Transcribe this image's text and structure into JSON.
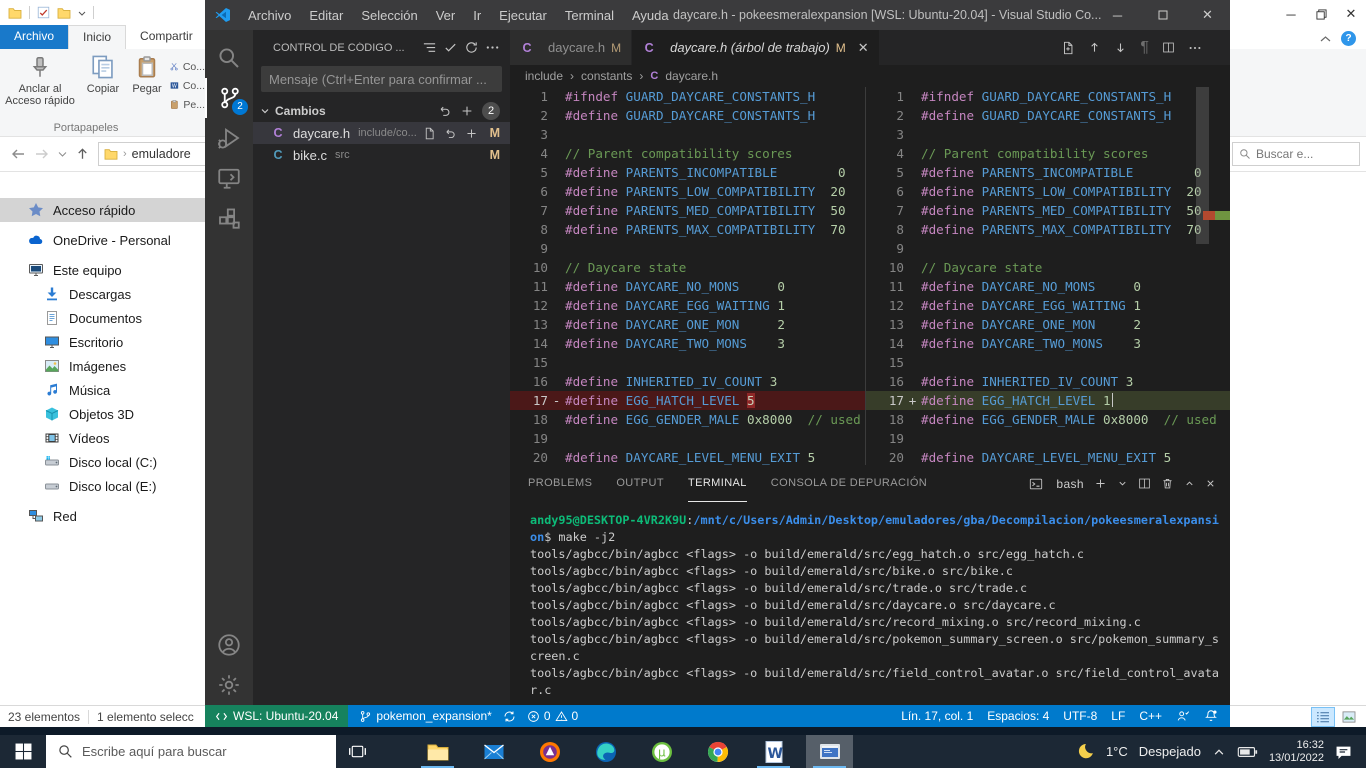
{
  "explorer": {
    "tabs": {
      "file": "Archivo",
      "home": "Inicio",
      "share": "Compartir"
    },
    "ribbon": {
      "pin_line1": "Anclar al",
      "pin_line2": "Acceso rápido",
      "copy": "Copiar",
      "paste": "Pegar",
      "cut_small": "Co...",
      "copy_path_small": "Co...",
      "paste_shortcut_small": "Pe...",
      "group": "Portapapeles"
    },
    "address_crumb": "emuladore",
    "search_placeholder": "Buscar e...",
    "nav": [
      {
        "label": "Acceso rápido",
        "icon": "star",
        "level": 0,
        "selected": true
      },
      {
        "label": "OneDrive - Personal",
        "icon": "cloud",
        "level": 0
      },
      {
        "label": "Este equipo",
        "icon": "pc",
        "level": 0
      },
      {
        "label": "Descargas",
        "icon": "download",
        "level": 1
      },
      {
        "label": "Documentos",
        "icon": "document",
        "level": 1
      },
      {
        "label": "Escritorio",
        "icon": "desktop",
        "level": 1
      },
      {
        "label": "Imágenes",
        "icon": "image",
        "level": 1
      },
      {
        "label": "Música",
        "icon": "music",
        "level": 1
      },
      {
        "label": "Objetos 3D",
        "icon": "cube",
        "level": 1
      },
      {
        "label": "Vídeos",
        "icon": "video",
        "level": 1
      },
      {
        "label": "Disco local (C:)",
        "icon": "drive-c",
        "level": 1
      },
      {
        "label": "Disco local (E:)",
        "icon": "drive",
        "level": 1
      },
      {
        "label": "Red",
        "icon": "network",
        "level": 0
      }
    ],
    "status": {
      "items": "23 elementos",
      "selected": "1 elemento selecc"
    }
  },
  "vscode": {
    "titlebar": {
      "menus": [
        "Archivo",
        "Editar",
        "Selección",
        "Ver",
        "Ir",
        "Ejecutar",
        "Terminal",
        "Ayuda"
      ],
      "title": "daycare.h - pokeesmeralexpansion [WSL: Ubuntu-20.04] - Visual Studio Co..."
    },
    "activitybar": {
      "items": [
        {
          "icon": "search",
          "name": "search"
        },
        {
          "icon": "source-control",
          "name": "source-control",
          "active": true,
          "badge": "2"
        },
        {
          "icon": "debug",
          "name": "run-and-debug"
        },
        {
          "icon": "remote",
          "name": "remote-explorer"
        },
        {
          "icon": "extensions",
          "name": "extensions"
        }
      ],
      "bottom": [
        {
          "icon": "account",
          "name": "accounts"
        },
        {
          "icon": "gear",
          "name": "settings"
        }
      ]
    },
    "scm": {
      "title": "CONTROL DE CÓDIGO ...",
      "message_placeholder": "Mensaje (Ctrl+Enter para confirmar ...",
      "changes_label": "Cambios",
      "changes_count": "2",
      "files": [
        {
          "name": "daycare.h",
          "path": "include/co...",
          "badge": "M"
        },
        {
          "name": "bike.c",
          "path": "src",
          "badge": "M"
        }
      ]
    },
    "editor": {
      "tabs": [
        {
          "name": "daycare.h",
          "badge": "M"
        },
        {
          "name": "daycare.h (árbol de trabajo)",
          "badge": "M"
        }
      ],
      "breadcrumb": [
        "include",
        "constants",
        "daycare.h"
      ]
    },
    "diff": {
      "left": [
        {
          "n": "1",
          "s": [
            [
              "d",
              "#ifndef"
            ],
            [
              "i",
              " GUARD_DAYCARE_CONSTANTS_H"
            ]
          ]
        },
        {
          "n": "2",
          "s": [
            [
              "d",
              "#define"
            ],
            [
              "i",
              " GUARD_DAYCARE_CONSTANTS_H"
            ]
          ]
        },
        {
          "n": "3",
          "s": []
        },
        {
          "n": "4",
          "s": [
            [
              "c",
              "// Parent compatibility scores"
            ]
          ]
        },
        {
          "n": "5",
          "s": [
            [
              "d",
              "#define"
            ],
            [
              "i",
              " PARENTS_INCOMPATIBLE"
            ],
            [
              "u",
              "        0"
            ]
          ]
        },
        {
          "n": "6",
          "s": [
            [
              "d",
              "#define"
            ],
            [
              "i",
              " PARENTS_LOW_COMPATIBILITY"
            ],
            [
              "u",
              "  20"
            ]
          ]
        },
        {
          "n": "7",
          "s": [
            [
              "d",
              "#define"
            ],
            [
              "i",
              " PARENTS_MED_COMPATIBILITY"
            ],
            [
              "u",
              "  50"
            ]
          ]
        },
        {
          "n": "8",
          "s": [
            [
              "d",
              "#define"
            ],
            [
              "i",
              " PARENTS_MAX_COMPATIBILITY"
            ],
            [
              "u",
              "  70"
            ]
          ]
        },
        {
          "n": "9",
          "s": []
        },
        {
          "n": "10",
          "s": [
            [
              "c",
              "// Daycare state"
            ]
          ]
        },
        {
          "n": "11",
          "s": [
            [
              "d",
              "#define"
            ],
            [
              "i",
              " DAYCARE_NO_MONS"
            ],
            [
              "u",
              "     0"
            ]
          ]
        },
        {
          "n": "12",
          "s": [
            [
              "d",
              "#define"
            ],
            [
              "i",
              " DAYCARE_EGG_WAITING"
            ],
            [
              "u",
              " 1"
            ]
          ]
        },
        {
          "n": "13",
          "s": [
            [
              "d",
              "#define"
            ],
            [
              "i",
              " DAYCARE_ONE_MON"
            ],
            [
              "u",
              "     2"
            ]
          ]
        },
        {
          "n": "14",
          "s": [
            [
              "d",
              "#define"
            ],
            [
              "i",
              " DAYCARE_TWO_MONS"
            ],
            [
              "u",
              "    3"
            ]
          ]
        },
        {
          "n": "15",
          "s": []
        },
        {
          "n": "16",
          "s": [
            [
              "d",
              "#define"
            ],
            [
              "i",
              " INHERITED_IV_COUNT"
            ],
            [
              "u",
              " 3"
            ]
          ]
        },
        {
          "n": "17",
          "sign": "-",
          "t": "rm",
          "s": [
            [
              "d",
              "#define"
            ],
            [
              "i",
              " EGG_HATCH_LEVEL "
            ],
            [
              "r",
              "5"
            ]
          ]
        },
        {
          "n": "18",
          "s": [
            [
              "d",
              "#define"
            ],
            [
              "i",
              " EGG_GENDER_MALE"
            ],
            [
              "u",
              " 0x8000"
            ],
            [
              "c",
              "  // used"
            ]
          ]
        },
        {
          "n": "19",
          "s": []
        },
        {
          "n": "20",
          "s": [
            [
              "d",
              "#define"
            ],
            [
              "i",
              " DAYCARE_LEVEL_MENU_EXIT"
            ],
            [
              "u",
              " 5"
            ]
          ]
        }
      ],
      "right": [
        {
          "n": "1",
          "s": [
            [
              "d",
              "#ifndef"
            ],
            [
              "i",
              " GUARD_DAYCARE_CONSTANTS_H"
            ]
          ]
        },
        {
          "n": "2",
          "s": [
            [
              "d",
              "#define"
            ],
            [
              "i",
              " GUARD_DAYCARE_CONSTANTS_H"
            ]
          ]
        },
        {
          "n": "3",
          "s": []
        },
        {
          "n": "4",
          "s": [
            [
              "c",
              "// Parent compatibility scores"
            ]
          ]
        },
        {
          "n": "5",
          "s": [
            [
              "d",
              "#define"
            ],
            [
              "i",
              " PARENTS_INCOMPATIBLE"
            ],
            [
              "u",
              "        0"
            ]
          ]
        },
        {
          "n": "6",
          "s": [
            [
              "d",
              "#define"
            ],
            [
              "i",
              " PARENTS_LOW_COMPATIBILITY"
            ],
            [
              "u",
              "  20"
            ]
          ]
        },
        {
          "n": "7",
          "s": [
            [
              "d",
              "#define"
            ],
            [
              "i",
              " PARENTS_MED_COMPATIBILITY"
            ],
            [
              "u",
              "  50"
            ]
          ]
        },
        {
          "n": "8",
          "s": [
            [
              "d",
              "#define"
            ],
            [
              "i",
              " PARENTS_MAX_COMPATIBILITY"
            ],
            [
              "u",
              "  70"
            ]
          ]
        },
        {
          "n": "9",
          "s": []
        },
        {
          "n": "10",
          "s": [
            [
              "c",
              "// Daycare state"
            ]
          ]
        },
        {
          "n": "11",
          "s": [
            [
              "d",
              "#define"
            ],
            [
              "i",
              " DAYCARE_NO_MONS"
            ],
            [
              "u",
              "     0"
            ]
          ]
        },
        {
          "n": "12",
          "s": [
            [
              "d",
              "#define"
            ],
            [
              "i",
              " DAYCARE_EGG_WAITING"
            ],
            [
              "u",
              " 1"
            ]
          ]
        },
        {
          "n": "13",
          "s": [
            [
              "d",
              "#define"
            ],
            [
              "i",
              " DAYCARE_ONE_MON"
            ],
            [
              "u",
              "     2"
            ]
          ]
        },
        {
          "n": "14",
          "s": [
            [
              "d",
              "#define"
            ],
            [
              "i",
              " DAYCARE_TWO_MONS"
            ],
            [
              "u",
              "    3"
            ]
          ]
        },
        {
          "n": "15",
          "s": []
        },
        {
          "n": "16",
          "s": [
            [
              "d",
              "#define"
            ],
            [
              "i",
              " INHERITED_IV_COUNT"
            ],
            [
              "u",
              " 3"
            ]
          ]
        },
        {
          "n": "17",
          "sign": "+",
          "t": "ad",
          "cursor": true,
          "s": [
            [
              "d",
              "#define"
            ],
            [
              "i",
              " EGG_HATCH_LEVEL "
            ],
            [
              "u",
              "1"
            ]
          ]
        },
        {
          "n": "18",
          "s": [
            [
              "d",
              "#define"
            ],
            [
              "i",
              " EGG_GENDER_MALE"
            ],
            [
              "u",
              " 0x8000"
            ],
            [
              "c",
              "  // used"
            ]
          ]
        },
        {
          "n": "19",
          "s": []
        },
        {
          "n": "20",
          "s": [
            [
              "d",
              "#define"
            ],
            [
              "i",
              " DAYCARE_LEVEL_MENU_EXIT"
            ],
            [
              "u",
              " 5"
            ]
          ]
        }
      ]
    },
    "panel": {
      "tabs": [
        "PROBLEMS",
        "OUTPUT",
        "TERMINAL",
        "CONSOLA DE DEPURACIÓN"
      ],
      "active_tab": "TERMINAL",
      "shell": "bash",
      "lines": [
        [
          [
            "g",
            "andy95@DESKTOP-4VR2K9U"
          ],
          [
            "w",
            ":"
          ],
          [
            "b",
            "/mnt/c/Users/Admin/Desktop/emuladores/gba/Decompilacion/pokeesmeralexpansi"
          ]
        ],
        [
          [
            "b",
            "on"
          ],
          [
            "w",
            "$ make -j2"
          ]
        ],
        [
          [
            "w",
            "tools/agbcc/bin/agbcc <flags> -o build/emerald/src/egg_hatch.o src/egg_hatch.c"
          ]
        ],
        [
          [
            "w",
            "tools/agbcc/bin/agbcc <flags> -o build/emerald/src/bike.o src/bike.c"
          ]
        ],
        [
          [
            "w",
            "tools/agbcc/bin/agbcc <flags> -o build/emerald/src/trade.o src/trade.c"
          ]
        ],
        [
          [
            "w",
            "tools/agbcc/bin/agbcc <flags> -o build/emerald/src/daycare.o src/daycare.c"
          ]
        ],
        [
          [
            "w",
            "tools/agbcc/bin/agbcc <flags> -o build/emerald/src/record_mixing.o src/record_mixing.c"
          ]
        ],
        [
          [
            "w",
            "tools/agbcc/bin/agbcc <flags> -o build/emerald/src/pokemon_summary_screen.o src/pokemon_summary_s"
          ]
        ],
        [
          [
            "w",
            "creen.c"
          ]
        ],
        [
          [
            "w",
            "tools/agbcc/bin/agbcc <flags> -o build/emerald/src/field_control_avatar.o src/field_control_avata"
          ]
        ],
        [
          [
            "w",
            "r.c"
          ]
        ]
      ]
    },
    "statusbar": {
      "remote": "WSL: Ubuntu-20.04",
      "branch": "pokemon_expansion*",
      "errors": "0",
      "warnings": "0",
      "line": "Lín. 17, col. 1",
      "spaces": "Espacios: 4",
      "encoding": "UTF-8",
      "eol": "LF",
      "lang": "C++"
    }
  },
  "taskbar": {
    "search_placeholder": "Escribe aquí para buscar",
    "apps": [
      {
        "icon": "explorer",
        "name": "file-explorer",
        "running": true
      },
      {
        "icon": "mail",
        "name": "mail"
      },
      {
        "icon": "avast",
        "name": "avast-browser"
      },
      {
        "icon": "edge",
        "name": "edge"
      },
      {
        "icon": "utorrent",
        "name": "utorrent"
      },
      {
        "icon": "chrome",
        "name": "chrome"
      },
      {
        "icon": "word",
        "name": "word",
        "running": true
      },
      {
        "icon": "window",
        "name": "active-app-window",
        "running": true,
        "active": true
      }
    ],
    "tray": {
      "weather_temp": "1°C",
      "weather_cond": "Despejado",
      "time": "16:32",
      "date": "13/01/2022"
    }
  }
}
